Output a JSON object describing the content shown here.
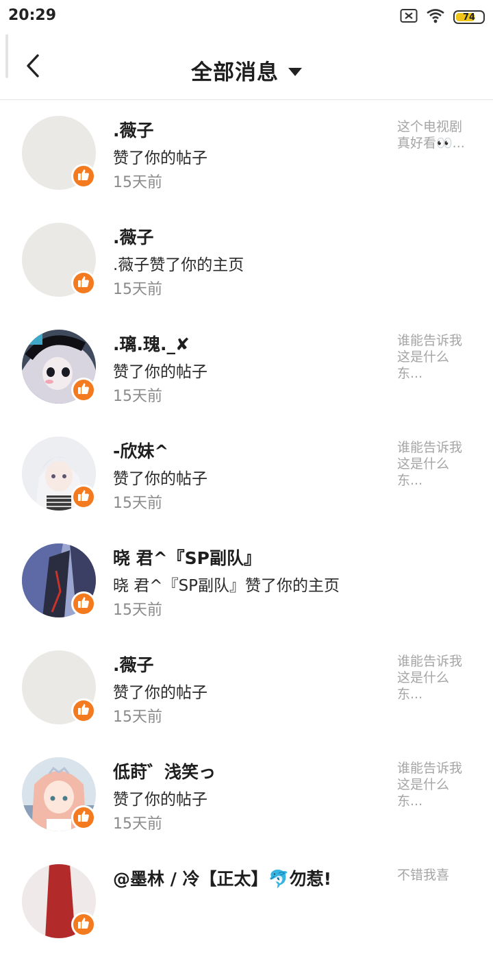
{
  "status": {
    "time": "20:29",
    "battery": "74",
    "battery_level": 0.74
  },
  "header": {
    "title": "全部消息"
  },
  "notifications": [
    {
      "name": "­­.薇子",
      "action": "赞了你的帖子",
      "time": "15天前",
      "preview": "这个电视剧真好看👀...",
      "avatar": "blank"
    },
    {
      "name": "­­.薇子",
      "action": "­­.薇子赞了你的主页",
      "time": "15天前",
      "preview": "",
      "avatar": "blank"
    },
    {
      "name": "­.璃.瑰._✘",
      "action": "赞了你的帖子",
      "time": "15天前",
      "preview": "谁能告诉我这是什么东...",
      "avatar": "anime-dark"
    },
    {
      "name": "-欣妹^",
      "action": "赞了你的帖子",
      "time": "15天前",
      "preview": "谁能告诉我这是什么东...",
      "avatar": "anime-light"
    },
    {
      "name": "晓 君^『SP副队』",
      "action": "晓 君^『SP副队』赞了你的主页",
      "time": "15天前",
      "preview": "",
      "avatar": "dark-blue"
    },
    {
      "name": "­­.薇子",
      "action": "赞了你的帖子",
      "time": "15天前",
      "preview": "谁能告诉我这是什么东...",
      "avatar": "blank"
    },
    {
      "name": "低莳゛浅笑っ",
      "action": "赞了你的帖子",
      "time": "15天前",
      "preview": "谁能告诉我这是什么东...",
      "avatar": "anime-pink"
    },
    {
      "name": "@墨林 / 冷【正太】🐬勿惹!",
      "action": "",
      "time": "",
      "preview": "不错我喜",
      "avatar": "red"
    }
  ],
  "colors": {
    "badge": "#f47a1f",
    "placeholder": "#ebe9e6"
  }
}
